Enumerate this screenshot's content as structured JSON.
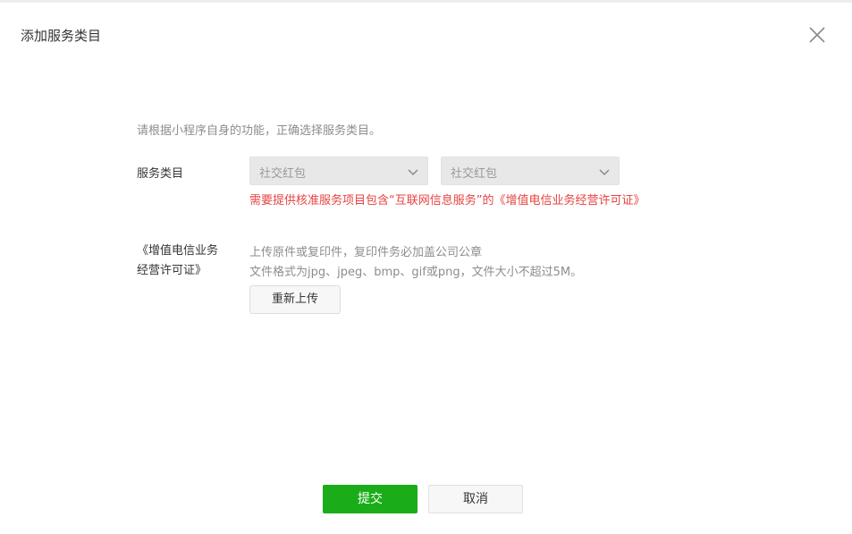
{
  "dialog": {
    "title": "添加服务类目",
    "close_icon": "close-icon"
  },
  "form": {
    "hint": "请根据小程序自身的功能，正确选择服务类目。",
    "category": {
      "label": "服务类目",
      "select_1_value": "社交红包",
      "select_2_value": "社交红包",
      "warning": "需要提供核准服务项目包含“互联网信息服务”的《增值电信业务经营许可证》"
    },
    "license": {
      "label": "《增值电信业务经营许可证》",
      "desc_line1": "上传原件或复印件，复印件务必加盖公司公章",
      "desc_line2": "文件格式为jpg、jpeg、bmp、gif或png，文件大小不超过5M。",
      "reupload_label": "重新上传"
    }
  },
  "footer": {
    "submit_label": "提交",
    "cancel_label": "取消"
  },
  "colors": {
    "primary_green": "#1aad19",
    "warning_red": "#e64340",
    "muted_text": "#8d8d8d"
  }
}
